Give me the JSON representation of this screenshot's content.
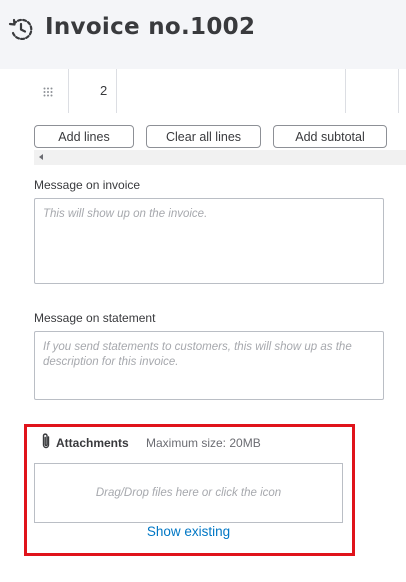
{
  "header": {
    "title": "Invoice no.1002",
    "icon": "history-icon"
  },
  "line_row": {
    "number": "2"
  },
  "buttons": {
    "add_lines": "Add lines",
    "clear_all_lines": "Clear all lines",
    "add_subtotal": "Add subtotal"
  },
  "message_invoice": {
    "label": "Message on invoice",
    "placeholder": "This will show up on the invoice."
  },
  "message_statement": {
    "label": "Message on statement",
    "placeholder": "If you send statements to customers, this will show up as the description for this invoice."
  },
  "attachments": {
    "label": "Attachments",
    "max_size": "Maximum size: 20MB",
    "dropzone_text": "Drag/Drop files here or click the icon",
    "show_existing": "Show existing"
  },
  "colors": {
    "highlight": "#e0131b",
    "link": "#0077c5"
  }
}
